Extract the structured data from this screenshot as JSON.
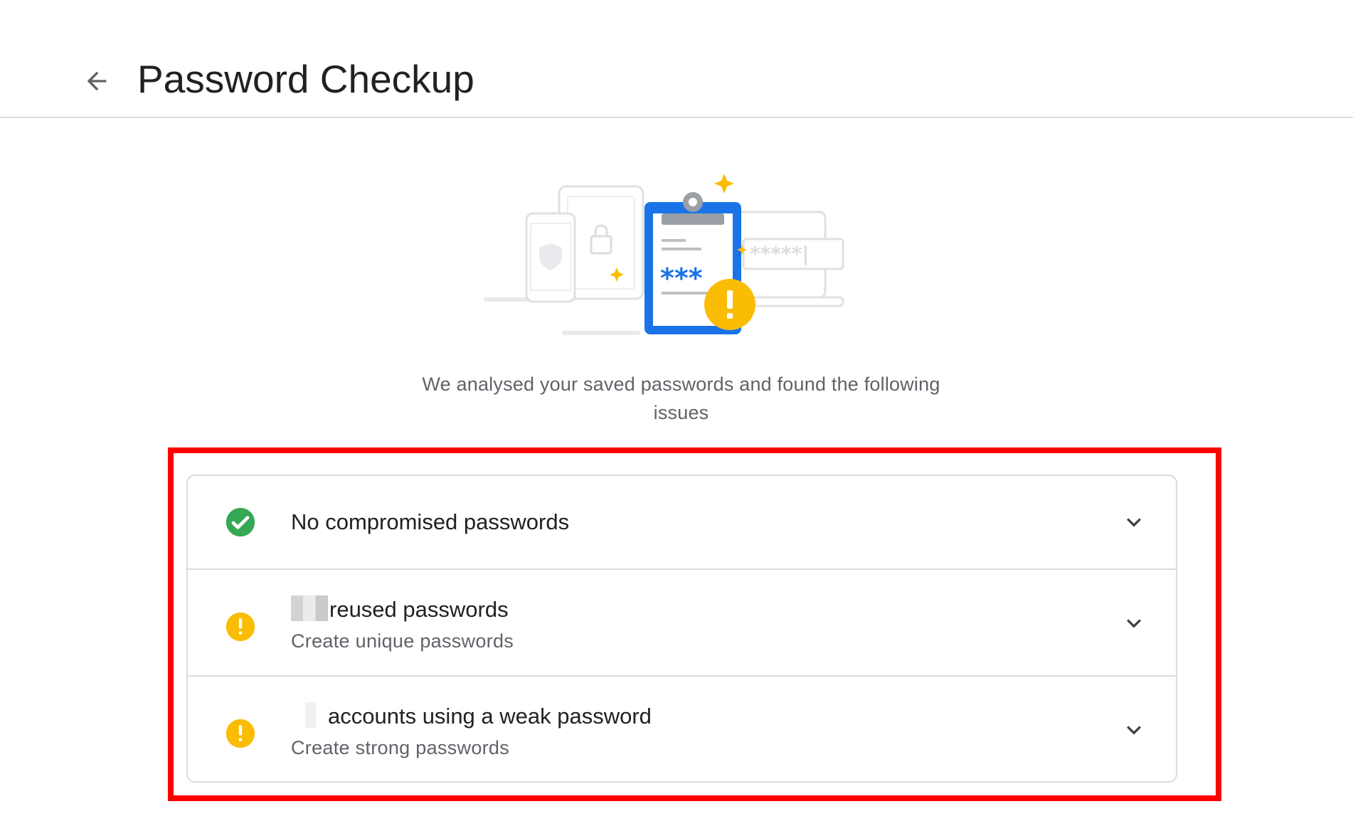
{
  "header": {
    "title": "Password Checkup",
    "back_icon": "arrow-back-icon"
  },
  "intro": {
    "text": "We analysed your saved passwords and found the following issues"
  },
  "hero": {
    "masked_password": "***",
    "placeholder_stars": "*****|"
  },
  "colors": {
    "accent_blue": "#1a73e8",
    "success_green": "#34a853",
    "warning_yellow": "#fbbc04",
    "highlight_red": "#ff0000",
    "divider": "#dadce0"
  },
  "issues": [
    {
      "icon": "check-circle-icon",
      "title": "No compromised passwords",
      "subtitle": ""
    },
    {
      "icon": "warning-icon",
      "title": "reused passwords",
      "subtitle": "Create unique passwords"
    },
    {
      "icon": "warning-icon",
      "title": "accounts using a weak password",
      "subtitle": "Create strong passwords"
    }
  ]
}
